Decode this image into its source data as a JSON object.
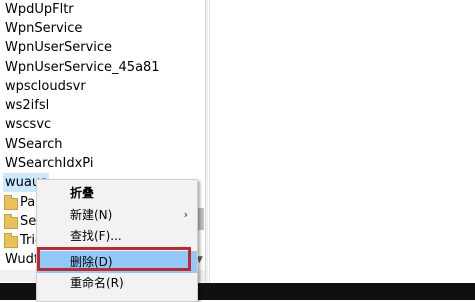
{
  "tree": {
    "items": [
      {
        "label": "WpdUpFltr"
      },
      {
        "label": "WpnService"
      },
      {
        "label": "WpnUserService"
      },
      {
        "label": "WpnUserService_45a81"
      },
      {
        "label": "wpscloudsvr"
      },
      {
        "label": "ws2ifsl"
      },
      {
        "label": "wscsvc"
      },
      {
        "label": "WSearch"
      },
      {
        "label": "WSearchIdxPi"
      },
      {
        "label": "wuaus"
      }
    ],
    "subfolders": [
      {
        "label": "Par"
      },
      {
        "label": "Sec"
      },
      {
        "label": "Trig"
      }
    ],
    "last_item": "Wudf"
  },
  "context_menu": {
    "items": [
      {
        "label": "折叠",
        "bold": true
      },
      {
        "label": "新建(N)",
        "submenu": true
      },
      {
        "label": "查找(F)..."
      },
      {
        "label": "删除(D)",
        "highlighted": true
      },
      {
        "label": "重命名(R)"
      }
    ]
  },
  "icons": {
    "folder": "folder-icon",
    "submenu": "chevron-right-icon",
    "scroll_down": "scroll-down-arrow-icon"
  },
  "colors": {
    "highlight": "#91c9f7",
    "annotation": "#c1272d",
    "folder": "#e8c15a"
  }
}
